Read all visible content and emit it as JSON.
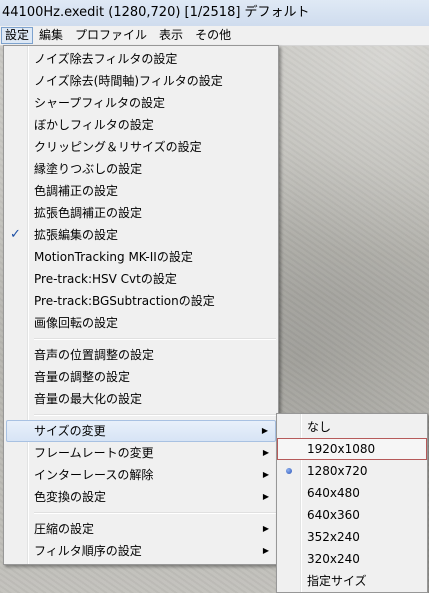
{
  "window": {
    "title": "44100Hz.exedit (1280,720)  [1/2518]  デフォルト"
  },
  "menubar": {
    "items": [
      "設定",
      "編集",
      "プロファイル",
      "表示",
      "その他"
    ]
  },
  "settings_menu": {
    "group1": [
      "ノイズ除去フィルタの設定",
      "ノイズ除去(時間軸)フィルタの設定",
      "シャープフィルタの設定",
      "ぼかしフィルタの設定",
      "クリッピング＆リサイズの設定",
      "縁塗りつぶしの設定",
      "色調補正の設定",
      "拡張色調補正の設定",
      "拡張編集の設定",
      "MotionTracking MK-IIの設定",
      "Pre-track:HSV Cvtの設定",
      "Pre-track:BGSubtractionの設定",
      "画像回転の設定"
    ],
    "checked_item": "拡張編集の設定",
    "group2": [
      "音声の位置調整の設定",
      "音量の調整の設定",
      "音量の最大化の設定"
    ],
    "group3": [
      "サイズの変更",
      "フレームレートの変更",
      "インターレースの解除",
      "色変換の設定"
    ],
    "group4": [
      "圧縮の設定",
      "フィルタ順序の設定"
    ]
  },
  "size_submenu": {
    "items": [
      "なし",
      "1920x1080",
      "1280x720",
      "640x480",
      "640x360",
      "352x240",
      "320x240",
      "指定サイズ"
    ],
    "selected": "1280x720",
    "highlighted": "1920x1080"
  }
}
